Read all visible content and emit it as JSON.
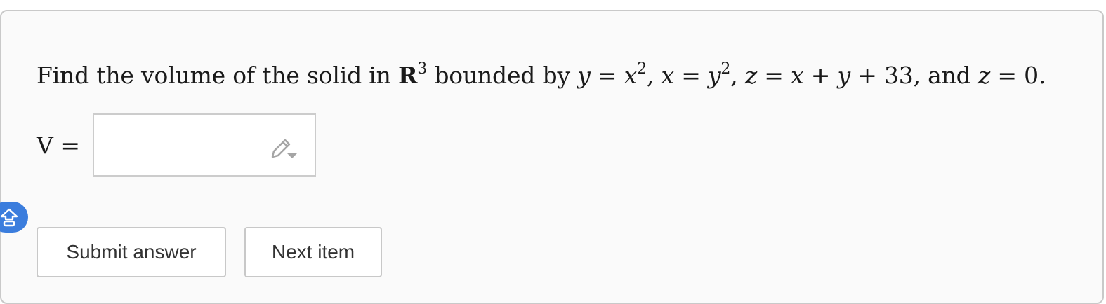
{
  "question": {
    "prefix": "Find the volume of the solid in ",
    "set_symbol": "R",
    "set_exponent": "3",
    "middle": " bounded by ",
    "eq1_lhs": "y",
    "eq1_rhs": "x",
    "eq1_exp": "2",
    "eq2_lhs": "x",
    "eq2_rhs": "y",
    "eq2_exp": "2",
    "eq3_lhs": "z",
    "eq3_rhs_a": "x",
    "eq3_rhs_b": "y",
    "eq3_const": "33",
    "conj": ", and ",
    "eq4_lhs": "z",
    "eq4_rhs": "0"
  },
  "answer": {
    "label": "V",
    "value": ""
  },
  "buttons": {
    "submit": "Submit answer",
    "next": "Next item"
  },
  "icons": {
    "input_tool": "pencil-icon",
    "side": "home-icon"
  },
  "colors": {
    "side_button": "#3b7ddd",
    "card_background": "#fafafa"
  }
}
